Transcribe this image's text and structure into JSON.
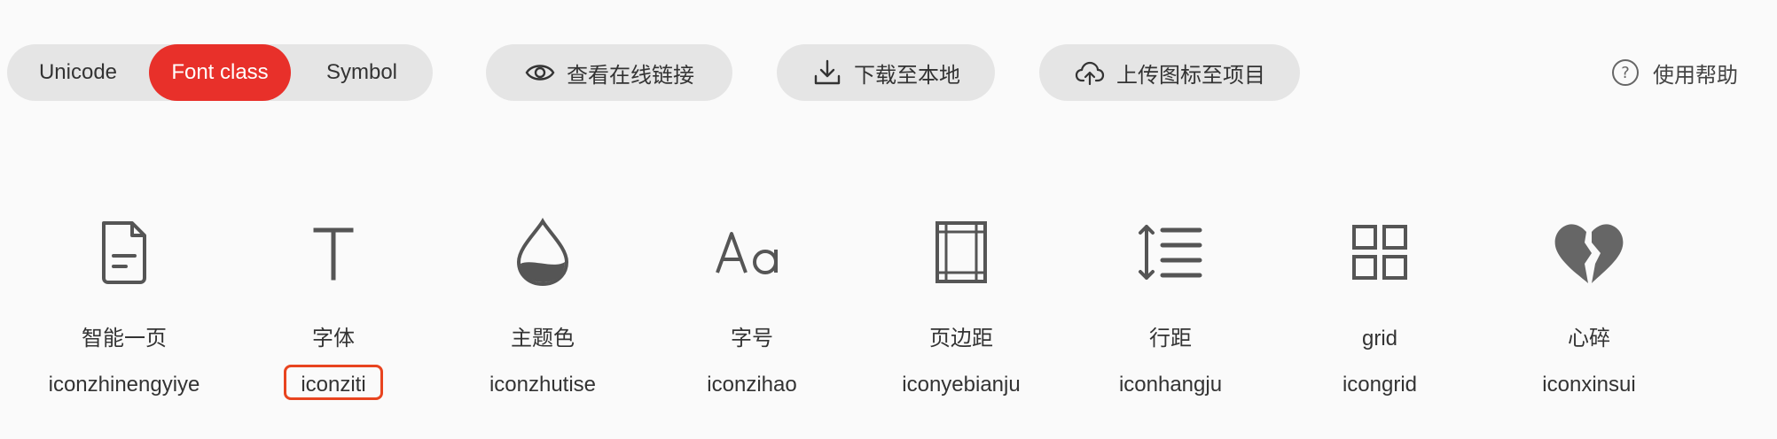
{
  "toolbar": {
    "tabs": [
      "Unicode",
      "Font class",
      "Symbol"
    ],
    "view_link": "查看在线链接",
    "download": "下载至本地",
    "upload": "上传图标至项目",
    "help": "使用帮助"
  },
  "icons": [
    {
      "label": "智能一页",
      "code": "iconzhinengyiye",
      "icon": "document-icon"
    },
    {
      "label": "字体",
      "code": "iconziti",
      "icon": "font-icon"
    },
    {
      "label": "主题色",
      "code": "iconzhutise",
      "icon": "droplet-icon"
    },
    {
      "label": "字号",
      "code": "iconzihao",
      "icon": "font-size-icon"
    },
    {
      "label": "页边距",
      "code": "iconyebianju",
      "icon": "page-margin-icon"
    },
    {
      "label": "行距",
      "code": "iconhangju",
      "icon": "line-spacing-icon"
    },
    {
      "label": "grid",
      "code": "icongrid",
      "icon": "grid-icon"
    },
    {
      "label": "心碎",
      "code": "iconxinsui",
      "icon": "broken-heart-icon"
    }
  ],
  "colors": {
    "accent": "#e8302a",
    "pill_bg": "#e5e5e5",
    "selected_border": "#e8441f"
  }
}
